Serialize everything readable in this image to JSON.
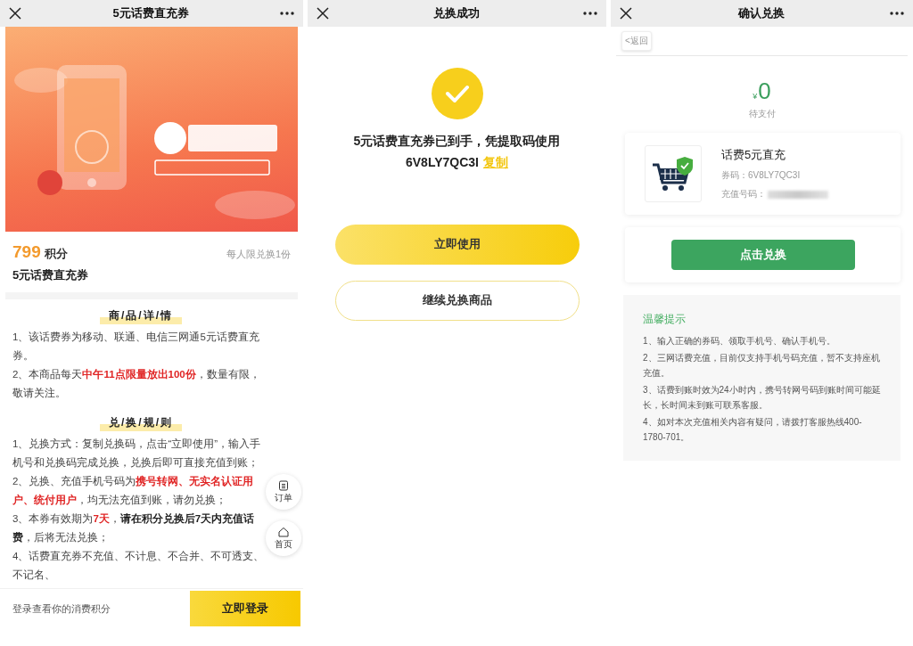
{
  "product_screen": {
    "title": "5元话费直充券",
    "points": "799",
    "points_unit": "积分",
    "limit": "每人限兑换1份",
    "name": "5元话费直充券",
    "sections": [
      {
        "heading": "商/品/详/情",
        "items": [
          "1、该话费券为移动、联通、电信三网通5元话费直充券。",
          "2、本商品每天**中午11点限量放出100份**，数量有限，敬请关注。"
        ]
      },
      {
        "heading": "兑/换/规/则",
        "items": [
          "1、兑换方式：复制兑换码，点击“立即使用”，输入手机号和兑换码完成兑换，兑换后即可直接充值到账；",
          "2、兑换、充值手机号码为**携号转网、无实名认证用户、统付用户**，均无法充值到账，请勿兑换；",
          "3、本券有效期为**7天**，*请在积分兑换后7天内充值话费*，后将无法兑换；",
          "4、话费直充券不充值、不计息、不合并、不可透支、不记名、"
        ]
      }
    ],
    "float_buttons": [
      {
        "kind": "orders",
        "label": "订单"
      },
      {
        "kind": "home",
        "label": "首页"
      }
    ],
    "footer": {
      "hint": "登录查看你的消费积分",
      "button": "立即登录"
    }
  },
  "success_screen": {
    "title": "兑换成功",
    "message": "5元话费直充券已到手，凭提取码使用",
    "code": "6V8LY7QC3I",
    "copy_link": "复制",
    "buttons": [
      {
        "kind": "primary",
        "label": "立即使用"
      },
      {
        "kind": "outline",
        "label": "继续兑换商品"
      }
    ]
  },
  "confirm_screen": {
    "title": "确认兑换",
    "back_button": "<返回",
    "currency": "¥",
    "amount": "0",
    "amount_caption": "待支付",
    "product": {
      "name": "话费5元直充",
      "code": "券码：6V8LY7QC3I",
      "phone_label": "充值号码："
    },
    "submit": "点击兑换",
    "tips": {
      "heading": "温馨提示",
      "items": [
        "1、输入正确的券码、领取手机号、确认手机号。",
        "2、三网话费充值，目前仅支持手机号码充值，暂不支持座机充值。",
        "3、话费到账时效为24小时内，携号转网号码到账时间可能延长，长时间未到账可联系客服。",
        "4、如对本次充值相关内容有疑问，请拨打客服热线400-1780-701。"
      ]
    }
  }
}
